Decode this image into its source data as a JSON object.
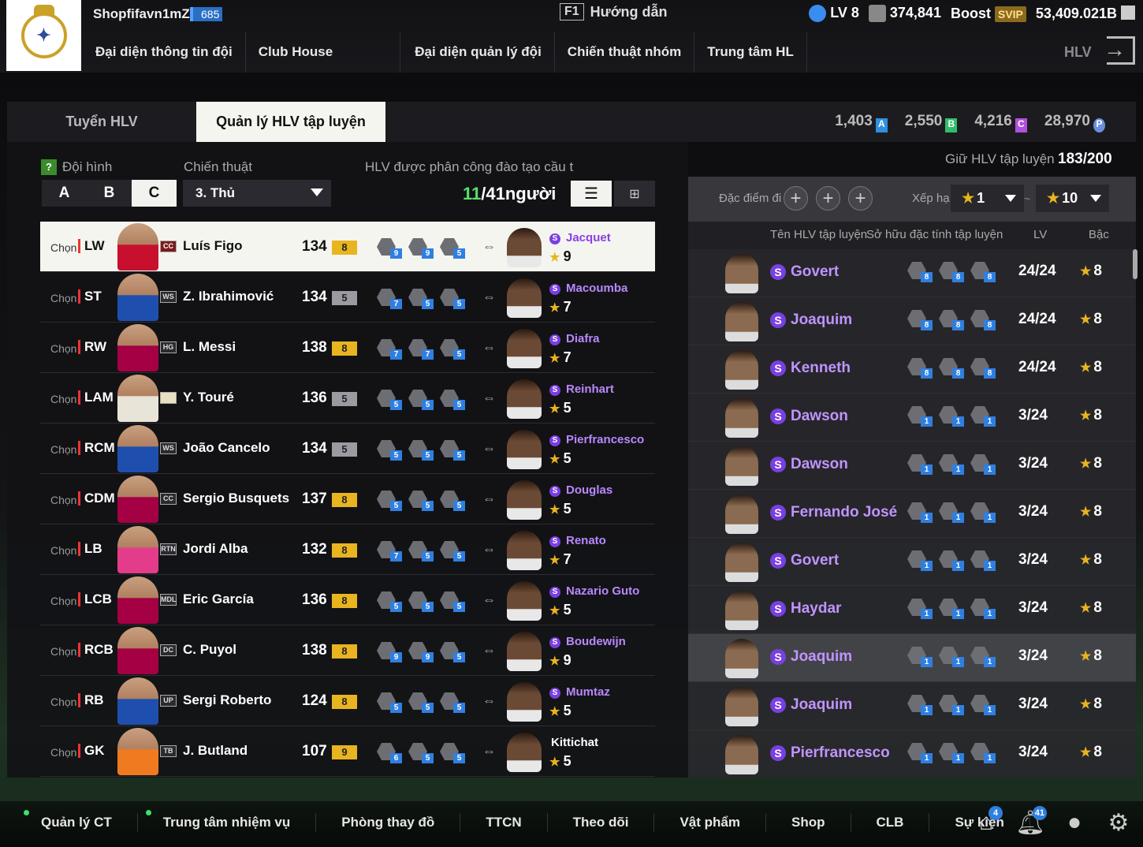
{
  "header": {
    "username": "Shopfifavn1mZ",
    "user_level": "685",
    "guide_key": "F1",
    "guide_label": "Hướng dẫn",
    "level": "LV 8",
    "coins": "374,841",
    "boost": "Boost",
    "svip": "SVIP",
    "balance": "53,409.021B",
    "hlv_label": "HLV",
    "nav": [
      "Đại diện thông tin đội",
      "Club House",
      "Đại diện quản lý đội",
      "Chiến thuật nhóm",
      "Trung tâm HL"
    ]
  },
  "tabs": {
    "recruit": "Tuyển HLV",
    "manage": "Quản lý HLV tập luyện"
  },
  "currencies": [
    {
      "value": "1,403",
      "tag": "A",
      "color": "#2f8fe0"
    },
    {
      "value": "2,550",
      "tag": "B",
      "color": "#2fbf6a"
    },
    {
      "value": "4,216",
      "tag": "C",
      "color": "#b04fe0"
    },
    {
      "value": "28,970",
      "tag": "P",
      "color": "#6a8fe0"
    }
  ],
  "left": {
    "formation_label": "Đội hình",
    "formation_options": [
      "A",
      "B",
      "C"
    ],
    "formation_selected": "C",
    "tactic_label": "Chiến thuật",
    "tactic_value": "3. Thủ",
    "assigned_label": "HLV được phân công đào tạo cầu t",
    "assigned_num": "11",
    "assigned_rest": "/41người",
    "choose_label": "Chọn",
    "players": [
      {
        "pos": "LW",
        "season": "CC",
        "name": "Luís Figo",
        "ovr": "134",
        "upg": "8",
        "upg_color": "#e8b420",
        "traits": [
          "9",
          "9",
          "5"
        ],
        "coach": "Jacquet",
        "coach_special": true,
        "coach_star": "9",
        "kit": "#c8102e",
        "selected": true
      },
      {
        "pos": "ST",
        "season": "WS",
        "name": "Z. Ibrahimović",
        "ovr": "134",
        "upg": "5",
        "upg_color": "#9a9aa0",
        "traits": [
          "7",
          "5",
          "5"
        ],
        "coach": "Macoumba",
        "coach_special": true,
        "coach_star": "7",
        "kit": "#1f4fae"
      },
      {
        "pos": "RW",
        "season": "HG",
        "name": "L. Messi",
        "ovr": "138",
        "upg": "8",
        "upg_color": "#e8b420",
        "traits": [
          "7",
          "7",
          "5"
        ],
        "coach": "Diafra",
        "coach_special": true,
        "coach_star": "7",
        "kit": "#a50044"
      },
      {
        "pos": "LAM",
        "season": "",
        "name": "Y. Touré",
        "ovr": "136",
        "upg": "5",
        "upg_color": "#9a9aa0",
        "traits": [
          "5",
          "5",
          "5"
        ],
        "coach": "Reinhart",
        "coach_special": true,
        "coach_star": "5",
        "kit": "#e8e4d8"
      },
      {
        "pos": "RCM",
        "season": "WS",
        "name": "João Cancelo",
        "ovr": "134",
        "upg": "5",
        "upg_color": "#9a9aa0",
        "traits": [
          "5",
          "5",
          "5"
        ],
        "coach": "Pierfrancesco",
        "coach_special": true,
        "coach_star": "5",
        "kit": "#1f4fae"
      },
      {
        "pos": "CDM",
        "season": "CC",
        "name": "Sergio Busquets",
        "ovr": "137",
        "upg": "8",
        "upg_color": "#e8b420",
        "traits": [
          "5",
          "5",
          "5"
        ],
        "coach": "Douglas",
        "coach_special": true,
        "coach_star": "5",
        "kit": "#a50044"
      },
      {
        "pos": "LB",
        "season": "RTN",
        "name": "Jordi Alba",
        "ovr": "132",
        "upg": "8",
        "upg_color": "#e8b420",
        "traits": [
          "7",
          "5",
          "5"
        ],
        "coach": "Renato",
        "coach_special": true,
        "coach_star": "7",
        "kit": "#e23c8a"
      },
      {
        "pos": "LCB",
        "season": "MDL",
        "name": "Eric García",
        "ovr": "136",
        "upg": "8",
        "upg_color": "#e8b420",
        "traits": [
          "5",
          "5",
          "5"
        ],
        "coach": "Nazario Guto",
        "coach_special": true,
        "coach_star": "5",
        "kit": "#a50044"
      },
      {
        "pos": "RCB",
        "season": "DC",
        "name": "C. Puyol",
        "ovr": "138",
        "upg": "8",
        "upg_color": "#e8b420",
        "traits": [
          "9",
          "9",
          "5"
        ],
        "coach": "Boudewijn",
        "coach_special": true,
        "coach_star": "9",
        "kit": "#a50044"
      },
      {
        "pos": "RB",
        "season": "UP",
        "name": "Sergi Roberto",
        "ovr": "124",
        "upg": "8",
        "upg_color": "#e8b420",
        "traits": [
          "5",
          "5",
          "5"
        ],
        "coach": "Mumtaz",
        "coach_special": true,
        "coach_star": "5",
        "kit": "#1f4fae"
      },
      {
        "pos": "GK",
        "season": "TB",
        "name": "J. Butland",
        "ovr": "107",
        "upg": "9",
        "upg_color": "#e8b420",
        "traits": [
          "6",
          "5",
          "5"
        ],
        "coach": "Kittichat",
        "coach_special": false,
        "coach_star": "5",
        "kit": "#f07a20"
      }
    ]
  },
  "right": {
    "keep_label": "Giữ HLV tập luyện",
    "keep_count": "183/200",
    "trait_filter_label": "Đặc điểm đi",
    "rank_label": "Xếp hạ",
    "rank_from": "1",
    "rank_to": "10",
    "tilde": "~",
    "col_name": "Tên HLV tập luyện",
    "col_traits": "Sở hữu đặc tính tập luyện",
    "col_lv": "LV",
    "col_rank": "Bậc",
    "coaches": [
      {
        "name": "Govert",
        "traits": [
          "8",
          "8",
          "8"
        ],
        "lv": "24/24",
        "rank": "8"
      },
      {
        "name": "Joaquim",
        "traits": [
          "8",
          "8",
          "8"
        ],
        "lv": "24/24",
        "rank": "8"
      },
      {
        "name": "Kenneth",
        "traits": [
          "8",
          "8",
          "8"
        ],
        "lv": "24/24",
        "rank": "8"
      },
      {
        "name": "Dawson",
        "traits": [
          "1",
          "1",
          "1"
        ],
        "lv": "3/24",
        "rank": "8"
      },
      {
        "name": "Dawson",
        "traits": [
          "1",
          "1",
          "1"
        ],
        "lv": "3/24",
        "rank": "8"
      },
      {
        "name": "Fernando José",
        "traits": [
          "1",
          "1",
          "1"
        ],
        "lv": "3/24",
        "rank": "8"
      },
      {
        "name": "Govert",
        "traits": [
          "1",
          "1",
          "1"
        ],
        "lv": "3/24",
        "rank": "8"
      },
      {
        "name": "Haydar",
        "traits": [
          "1",
          "1",
          "1"
        ],
        "lv": "3/24",
        "rank": "8"
      },
      {
        "name": "Joaquim",
        "traits": [
          "1",
          "1",
          "1"
        ],
        "lv": "3/24",
        "rank": "8",
        "highlight": true
      },
      {
        "name": "Joaquim",
        "traits": [
          "1",
          "1",
          "1"
        ],
        "lv": "3/24",
        "rank": "8"
      },
      {
        "name": "Pierfrancesco",
        "traits": [
          "1",
          "1",
          "1"
        ],
        "lv": "3/24",
        "rank": "8"
      }
    ]
  },
  "bottom": {
    "items": [
      {
        "label": "Quản lý CT",
        "dot": true
      },
      {
        "label": "Trung tâm nhiệm vụ",
        "dot": true
      },
      {
        "label": "Phòng thay đồ",
        "dot": false
      },
      {
        "label": "TTCN",
        "dot": false
      },
      {
        "label": "Theo dõi",
        "dot": false
      },
      {
        "label": "Vật phẩm",
        "dot": false
      },
      {
        "label": "Shop",
        "dot": false
      },
      {
        "label": "CLB",
        "dot": false
      },
      {
        "label": "Sự kiện",
        "dot": false
      }
    ],
    "mail_badge": "4",
    "bell_badge": "41"
  }
}
